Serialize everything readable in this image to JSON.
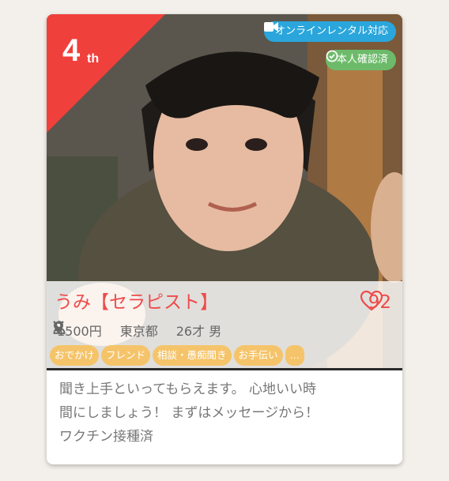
{
  "rank": {
    "number": "4",
    "suffix": "th"
  },
  "badges": {
    "online_rental": {
      "label": "オンラインレンタル対応",
      "icon": "video-camera-icon",
      "color": "#2aa6dc"
    },
    "verified": {
      "label": "本人確認済",
      "icon": "check-circle-icon",
      "color": "#6dbb6a"
    }
  },
  "profile": {
    "name": "うみ【セラピスト】",
    "likes": "92",
    "price": "1500円",
    "location": "東京都",
    "age_gender": "26才 男"
  },
  "tags": [
    "おでかけ",
    "フレンド",
    "相談・愚痴聞き",
    "お手伝い",
    "…"
  ],
  "description": [
    "聞き上手といってもらえます。 心地いい時",
    "間にしましょう！ まずはメッセージから！",
    "ワクチン接種済"
  ],
  "colors": {
    "accent": "#ee4b4b",
    "rank_ribbon": "#f0403c",
    "tag": "#f5c46a"
  }
}
